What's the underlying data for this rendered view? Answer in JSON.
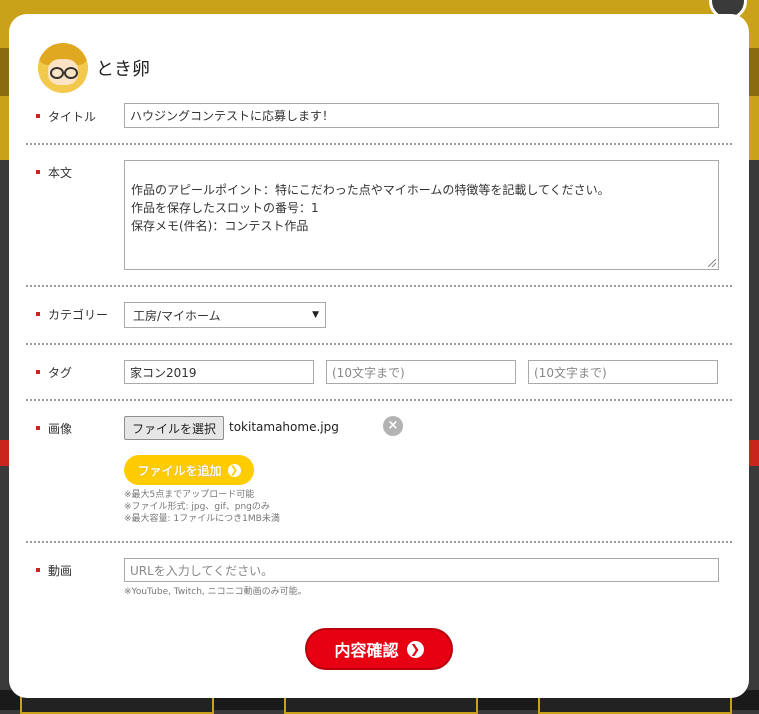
{
  "user": {
    "name": "とき卵"
  },
  "form": {
    "title": {
      "label": "タイトル",
      "value": "ハウジングコンテストに応募します！"
    },
    "body": {
      "label": "本文",
      "value": "作品のアピールポイント：特にこだわった点やマイホームの特徴等を記載してください。\n作品を保存したスロットの番号：1\n保存メモ(件名)：コンテスト作品"
    },
    "category": {
      "label": "カテゴリー",
      "selected": "工房/マイホーム"
    },
    "tags": {
      "label": "タグ",
      "fields": [
        {
          "value": "家コン2019",
          "placeholder": ""
        },
        {
          "value": "",
          "placeholder": "(10文字まで)"
        },
        {
          "value": "",
          "placeholder": "(10文字まで)"
        }
      ]
    },
    "image": {
      "label": "画像",
      "choose_button": "ファイルを選択",
      "file_name": "tokitamahome.jpg",
      "add_button": "ファイルを追加",
      "notes": [
        "※最大5点までアップロード可能",
        "※ファイル形式: jpg、gif、pngのみ",
        "※最大容量: 1ファイルにつき1MB未満"
      ]
    },
    "video": {
      "label": "動画",
      "placeholder": "URLを入力してください。",
      "note": "※YouTube, Twitch, ニコニコ動画のみ可能。"
    },
    "submit_button": "内容確認"
  },
  "colors": {
    "accent_red": "#e60012",
    "accent_yellow": "#ffcc00"
  }
}
